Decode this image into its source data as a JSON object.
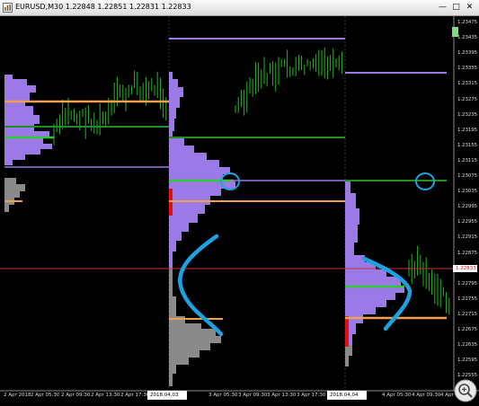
{
  "window": {
    "title": "EURUSD,M30  1.22848  1.22851  1.22831  1.22833",
    "controls": [
      "minimize",
      "maximize",
      "close"
    ]
  },
  "price_axis": {
    "ticks": [
      "1.23475",
      "1.23435",
      "1.23395",
      "1.23355",
      "1.23315",
      "1.23275",
      "1.23235",
      "1.23195",
      "1.23155",
      "1.23115",
      "1.23075",
      "1.23035",
      "1.22995",
      "1.22955",
      "1.22915",
      "1.22875",
      "1.22835",
      "1.22795",
      "1.22755",
      "1.22715",
      "1.22675",
      "1.22635",
      "1.22595",
      "1.22555"
    ],
    "bid_label": "1.22833"
  },
  "time_axis": {
    "labels": [
      "2 Apr 2018",
      "2 Apr 05:30",
      "2 Apr 09:30",
      "2 Apr 13:30",
      "2 Apr 17:30",
      "2018.04.03 00:30",
      "3 Apr 05:30",
      "3 Apr 09:30",
      "3 Apr 13:30",
      "3 Apr 17:30",
      "2018.04.04 00:30",
      "4 Apr 05:30",
      "4 Apr 09:30",
      "4 Apr 13:30"
    ]
  },
  "colors": {
    "background": "#000000",
    "candles": "#1fb81f",
    "profile_fill": "#9b79e6",
    "profile_gray": "#8a8a8a",
    "poc_line": "#2ecc2e",
    "value_area_line": "#f0a050",
    "level_line": "#9b79e6",
    "annotation": "#1aa3e0",
    "bid_line": "#c83232"
  },
  "icons": [
    "chart-window-icon",
    "zoom-icon"
  ]
}
